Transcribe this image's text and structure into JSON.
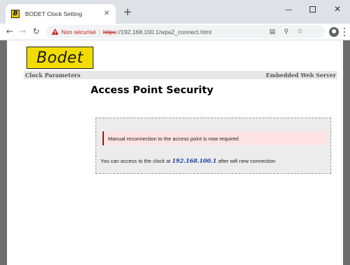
{
  "browser": {
    "tab_title": "BODET Clock Setting",
    "favicon_letter": "B",
    "security_label": "Non sécurisé",
    "separator": "|",
    "url_scheme": "https",
    "url_rest": "://192.168.100.1/wpa2_connect.html",
    "icons": [
      "close-icon",
      "plus-icon",
      "minimize-icon",
      "maximize-icon",
      "window-close-icon",
      "back-arrow-icon",
      "forward-arrow-icon",
      "reload-icon",
      "warning-triangle-icon",
      "translate-icon",
      "zoom-icon",
      "star-icon",
      "profile-icon",
      "kebab-menu-icon"
    ]
  },
  "page": {
    "logo_text": "Bodet",
    "clock_parameters": "Clock Parameters",
    "embedded_server": "Embedded Web Server",
    "title": "Access Point Security",
    "alert_message": "Manual reconnection to the access point is now required",
    "info_prefix": "You can access to the clock at",
    "info_ip": "192.168.100.1",
    "info_suffix": "after wifi new connection"
  },
  "colors": {
    "logo_background": "#f2dc00",
    "alert_background": "#fde3e3",
    "ip_link": "#1a3fa8",
    "security_warning": "#c5221f"
  }
}
